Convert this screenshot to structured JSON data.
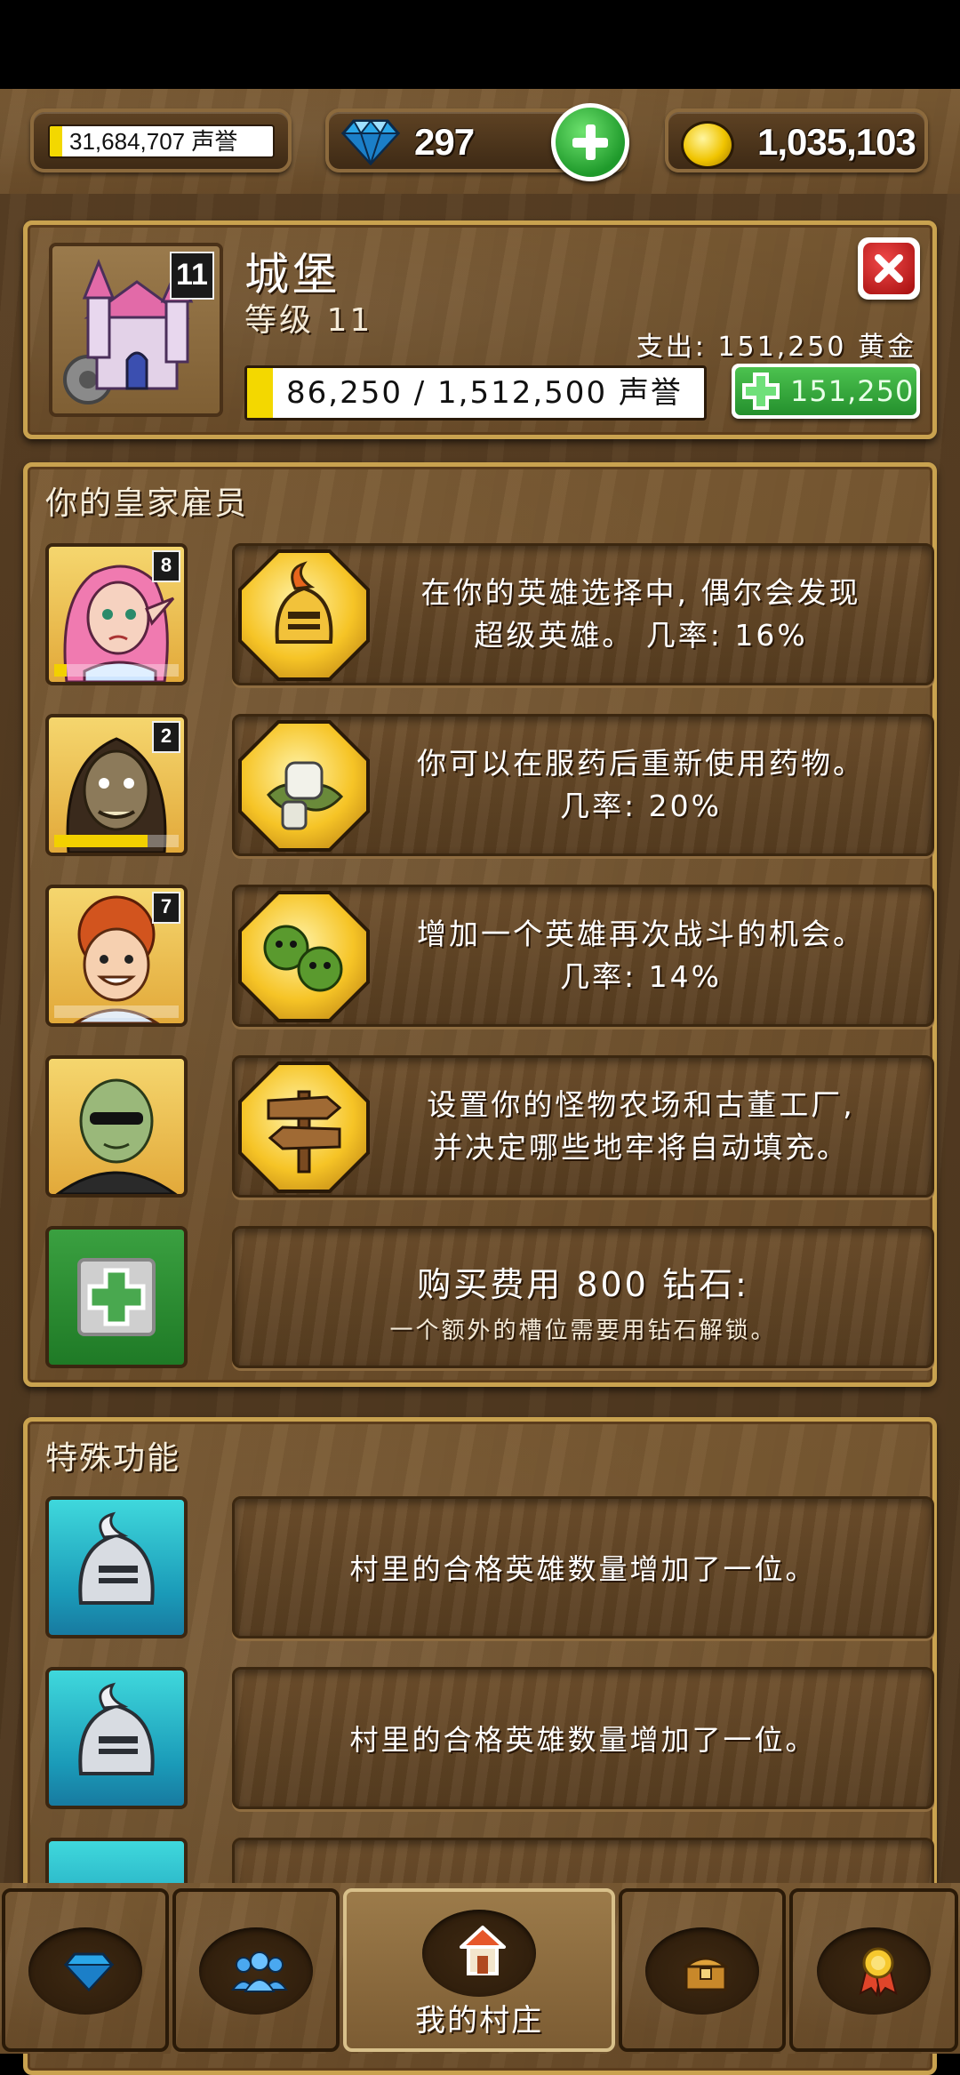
{
  "topbar": {
    "reputation": "31,684,707 声誉",
    "gems": "297",
    "gold": "1,035,103"
  },
  "castle": {
    "title": "城堡",
    "level_text": "等级 11",
    "level_badge": "11",
    "expense": "支出: 151,250 黄金",
    "progress_text": "86,250 / 1,512,500 声誉",
    "progress_fraction": 0.057,
    "upgrade_cost": "151,250"
  },
  "employees": {
    "title": "你的皇家雇员",
    "items": [
      {
        "level": "8",
        "line1": "在你的英雄选择中, 偶尔会发现",
        "line2": "超级英雄。 几率: 16%",
        "icon": "knight-helmet-icon",
        "xp": 0.1
      },
      {
        "level": "2",
        "line1": "你可以在服药后重新使用药物。",
        "line2": "几率: 20%",
        "icon": "herb-bandage-icon",
        "xp": 0.75
      },
      {
        "level": "7",
        "line1": "增加一个英雄再次战斗的机会。",
        "line2": "几率: 14%",
        "icon": "goblin-heads-icon",
        "xp": 0.0
      },
      {
        "level": "",
        "line1": "设置你的怪物农场和古董工厂,",
        "line2": "并决定哪些地牢将自动填充。",
        "icon": "signpost-icon",
        "xp": null
      }
    ],
    "buy_slot": {
      "title": "购买费用 800 钻石:",
      "subtitle": "一个额外的槽位需要用钻石解锁。"
    }
  },
  "special": {
    "title": "特殊功能",
    "items": [
      {
        "text": "村里的合格英雄数量增加了一位。",
        "icon": "knight-helmet-icon"
      },
      {
        "text": "村里的合格英雄数量增加了一位。",
        "icon": "knight-helmet-icon"
      }
    ]
  },
  "nav": {
    "tabs": [
      {
        "icon": "diamond-icon"
      },
      {
        "icon": "people-icon"
      },
      {
        "icon": "house-icon",
        "label": "我的村庄"
      },
      {
        "icon": "treasure-chest-icon"
      },
      {
        "icon": "medal-icon"
      }
    ]
  },
  "colors": {
    "accent_gold": "#c9a24f",
    "button_green": "#2fa63a",
    "close_red": "#b21414",
    "xp_yellow": "#f2d000"
  }
}
